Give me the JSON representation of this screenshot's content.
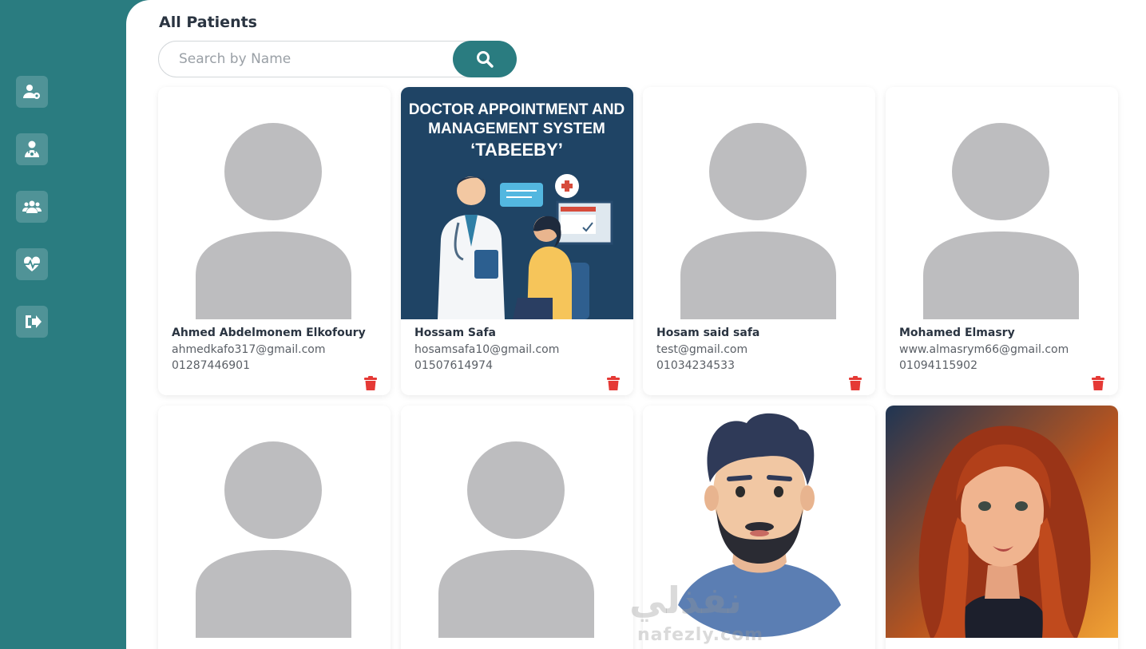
{
  "page": {
    "title": "All Patients"
  },
  "search": {
    "placeholder": "Search by Name",
    "button_icon": "search-icon"
  },
  "sidebar": {
    "items": [
      {
        "icon": "user-settings-icon"
      },
      {
        "icon": "doctor-icon"
      },
      {
        "icon": "users-group-icon"
      },
      {
        "icon": "heartbeat-icon"
      },
      {
        "icon": "logout-icon"
      }
    ]
  },
  "patients": [
    {
      "name": "Ahmed Abdelmonem Elkofoury",
      "email": "ahmedkafo317@gmail.com",
      "phone": "01287446901",
      "image": "default-avatar"
    },
    {
      "name": "Hossam Safa",
      "email": "hosamsafa10@gmail.com",
      "phone": "01507614974",
      "image": "doctor-appointment-banner",
      "image_text": [
        "DOCTOR APPOINTMENT AND",
        "MANAGEMENT SYSTEM",
        "‘TABEEBY’"
      ]
    },
    {
      "name": "Hosam said safa",
      "email": "test@gmail.com",
      "phone": "01034234533",
      "image": "default-avatar"
    },
    {
      "name": "Mohamed Elmasry",
      "email": "www.almasrym66@gmail.com",
      "phone": "01094115902",
      "image": "default-avatar"
    },
    {
      "image": "default-avatar"
    },
    {
      "image": "default-avatar"
    },
    {
      "image": "bearded-man-avatar"
    },
    {
      "image": "woman-portrait-avatar"
    }
  ],
  "colors": {
    "primary": "#2a7c80",
    "delete": "#e53935",
    "avatar_gray": "#bdbdbf"
  },
  "watermark": {
    "arabic": "نفذلي",
    "latin": "nafezly.com"
  }
}
